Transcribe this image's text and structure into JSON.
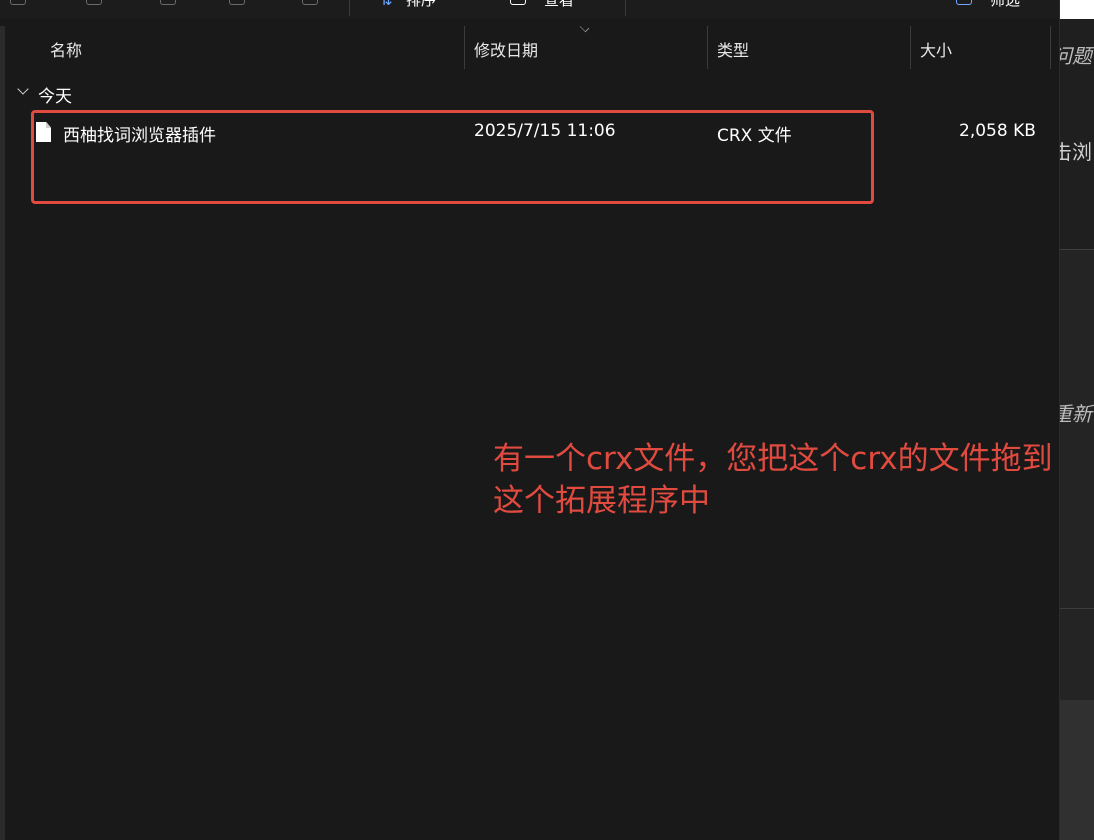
{
  "toolbar": {
    "sort_label": "排序",
    "view_label": "查看",
    "filter_label": "筛选"
  },
  "columns": {
    "name": "名称",
    "date_modified": "修改日期",
    "type": "类型",
    "size": "大小"
  },
  "group": {
    "label": "今天"
  },
  "files": [
    {
      "name": "西柚找词浏览器插件",
      "date_modified": "2025/7/15 11:06",
      "type": "CRX 文件",
      "size": "2,058 KB"
    }
  ],
  "annotation": {
    "text": "有一个crx文件，您把这个crx的文件拖到这个拓展程序中"
  },
  "background_window": {
    "fragments": [
      "问题",
      "击浏",
      "重新"
    ]
  },
  "colors": {
    "highlight": "#e04a3f",
    "background": "#191919"
  }
}
